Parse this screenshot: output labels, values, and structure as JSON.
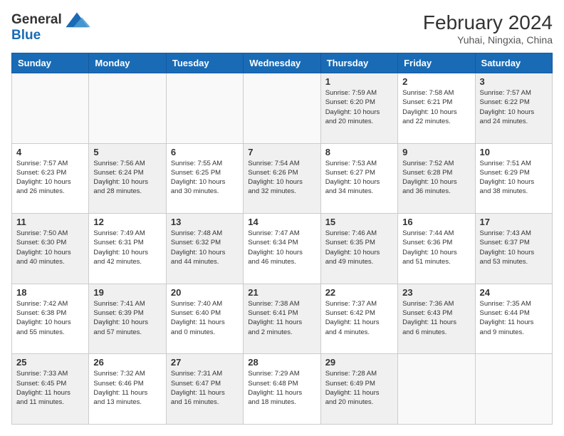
{
  "header": {
    "logo_general": "General",
    "logo_blue": "Blue",
    "title": "February 2024",
    "subtitle": "Yuhai, Ningxia, China"
  },
  "days_of_week": [
    "Sunday",
    "Monday",
    "Tuesday",
    "Wednesday",
    "Thursday",
    "Friday",
    "Saturday"
  ],
  "weeks": [
    [
      {
        "day": "",
        "info": "",
        "empty": true
      },
      {
        "day": "",
        "info": "",
        "empty": true
      },
      {
        "day": "",
        "info": "",
        "empty": true
      },
      {
        "day": "",
        "info": "",
        "empty": true
      },
      {
        "day": "1",
        "info": "Sunrise: 7:59 AM\nSunset: 6:20 PM\nDaylight: 10 hours\nand 20 minutes."
      },
      {
        "day": "2",
        "info": "Sunrise: 7:58 AM\nSunset: 6:21 PM\nDaylight: 10 hours\nand 22 minutes."
      },
      {
        "day": "3",
        "info": "Sunrise: 7:57 AM\nSunset: 6:22 PM\nDaylight: 10 hours\nand 24 minutes."
      }
    ],
    [
      {
        "day": "4",
        "info": "Sunrise: 7:57 AM\nSunset: 6:23 PM\nDaylight: 10 hours\nand 26 minutes."
      },
      {
        "day": "5",
        "info": "Sunrise: 7:56 AM\nSunset: 6:24 PM\nDaylight: 10 hours\nand 28 minutes."
      },
      {
        "day": "6",
        "info": "Sunrise: 7:55 AM\nSunset: 6:25 PM\nDaylight: 10 hours\nand 30 minutes."
      },
      {
        "day": "7",
        "info": "Sunrise: 7:54 AM\nSunset: 6:26 PM\nDaylight: 10 hours\nand 32 minutes."
      },
      {
        "day": "8",
        "info": "Sunrise: 7:53 AM\nSunset: 6:27 PM\nDaylight: 10 hours\nand 34 minutes."
      },
      {
        "day": "9",
        "info": "Sunrise: 7:52 AM\nSunset: 6:28 PM\nDaylight: 10 hours\nand 36 minutes."
      },
      {
        "day": "10",
        "info": "Sunrise: 7:51 AM\nSunset: 6:29 PM\nDaylight: 10 hours\nand 38 minutes."
      }
    ],
    [
      {
        "day": "11",
        "info": "Sunrise: 7:50 AM\nSunset: 6:30 PM\nDaylight: 10 hours\nand 40 minutes."
      },
      {
        "day": "12",
        "info": "Sunrise: 7:49 AM\nSunset: 6:31 PM\nDaylight: 10 hours\nand 42 minutes."
      },
      {
        "day": "13",
        "info": "Sunrise: 7:48 AM\nSunset: 6:32 PM\nDaylight: 10 hours\nand 44 minutes."
      },
      {
        "day": "14",
        "info": "Sunrise: 7:47 AM\nSunset: 6:34 PM\nDaylight: 10 hours\nand 46 minutes."
      },
      {
        "day": "15",
        "info": "Sunrise: 7:46 AM\nSunset: 6:35 PM\nDaylight: 10 hours\nand 49 minutes."
      },
      {
        "day": "16",
        "info": "Sunrise: 7:44 AM\nSunset: 6:36 PM\nDaylight: 10 hours\nand 51 minutes."
      },
      {
        "day": "17",
        "info": "Sunrise: 7:43 AM\nSunset: 6:37 PM\nDaylight: 10 hours\nand 53 minutes."
      }
    ],
    [
      {
        "day": "18",
        "info": "Sunrise: 7:42 AM\nSunset: 6:38 PM\nDaylight: 10 hours\nand 55 minutes."
      },
      {
        "day": "19",
        "info": "Sunrise: 7:41 AM\nSunset: 6:39 PM\nDaylight: 10 hours\nand 57 minutes."
      },
      {
        "day": "20",
        "info": "Sunrise: 7:40 AM\nSunset: 6:40 PM\nDaylight: 11 hours\nand 0 minutes."
      },
      {
        "day": "21",
        "info": "Sunrise: 7:38 AM\nSunset: 6:41 PM\nDaylight: 11 hours\nand 2 minutes."
      },
      {
        "day": "22",
        "info": "Sunrise: 7:37 AM\nSunset: 6:42 PM\nDaylight: 11 hours\nand 4 minutes."
      },
      {
        "day": "23",
        "info": "Sunrise: 7:36 AM\nSunset: 6:43 PM\nDaylight: 11 hours\nand 6 minutes."
      },
      {
        "day": "24",
        "info": "Sunrise: 7:35 AM\nSunset: 6:44 PM\nDaylight: 11 hours\nand 9 minutes."
      }
    ],
    [
      {
        "day": "25",
        "info": "Sunrise: 7:33 AM\nSunset: 6:45 PM\nDaylight: 11 hours\nand 11 minutes."
      },
      {
        "day": "26",
        "info": "Sunrise: 7:32 AM\nSunset: 6:46 PM\nDaylight: 11 hours\nand 13 minutes."
      },
      {
        "day": "27",
        "info": "Sunrise: 7:31 AM\nSunset: 6:47 PM\nDaylight: 11 hours\nand 16 minutes."
      },
      {
        "day": "28",
        "info": "Sunrise: 7:29 AM\nSunset: 6:48 PM\nDaylight: 11 hours\nand 18 minutes."
      },
      {
        "day": "29",
        "info": "Sunrise: 7:28 AM\nSunset: 6:49 PM\nDaylight: 11 hours\nand 20 minutes."
      },
      {
        "day": "",
        "info": "",
        "empty": true
      },
      {
        "day": "",
        "info": "",
        "empty": true
      }
    ]
  ]
}
